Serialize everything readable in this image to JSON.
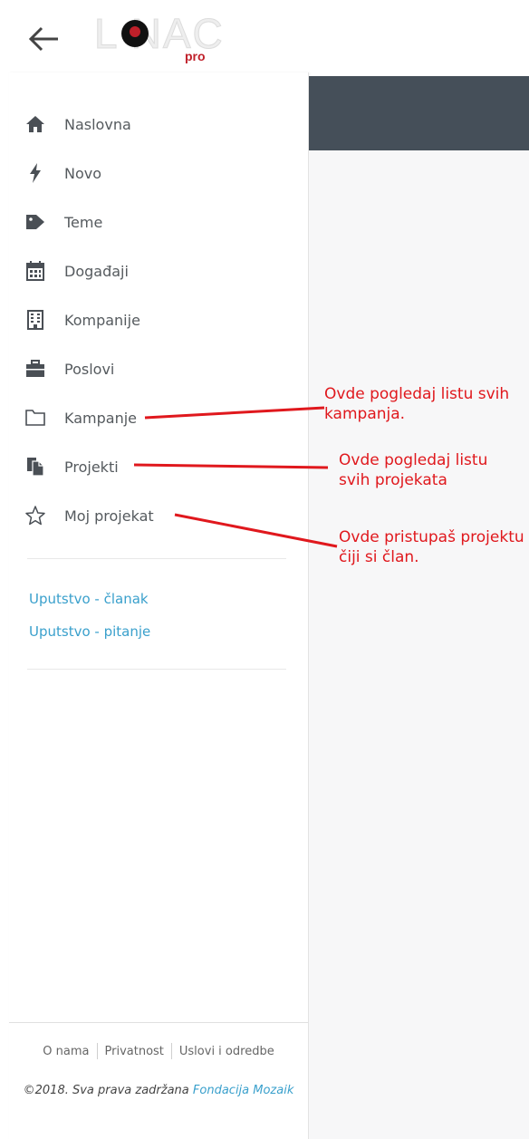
{
  "header": {
    "logo_text": "L NAC",
    "logo_sub": "pro"
  },
  "sidebar": {
    "items": [
      {
        "label": "Naslovna",
        "icon": "home-icon"
      },
      {
        "label": "Novo",
        "icon": "bolt-icon"
      },
      {
        "label": "Teme",
        "icon": "tag-icon"
      },
      {
        "label": "Događaji",
        "icon": "calendar-icon"
      },
      {
        "label": "Kompanije",
        "icon": "building-icon"
      },
      {
        "label": "Poslovi",
        "icon": "briefcase-icon"
      },
      {
        "label": "Kampanje",
        "icon": "folder-icon"
      },
      {
        "label": "Projekti",
        "icon": "copy-icon"
      },
      {
        "label": "Moj projekat",
        "icon": "star-icon"
      }
    ],
    "links": [
      "Uputstvo - članak",
      "Uputstvo - pitanje"
    ]
  },
  "footer": {
    "links": [
      "O nama",
      "Privatnost",
      "Uslovi i odredbe"
    ],
    "copyright_prefix": "©2018. Sva prava zadržana",
    "copyright_link": "Fondacija Mozaik"
  },
  "annotations": [
    {
      "line1": "Ovde pogledaj listu svih",
      "line2": "kampanja."
    },
    {
      "line1": "Ovde pogledaj listu",
      "line2": "svih projekata"
    },
    {
      "line1": "Ovde pristupaš projektu",
      "line2": "čiji si član."
    }
  ],
  "colors": {
    "annotation": "#e0181d",
    "link": "#3aa0cc",
    "header_band": "#454f59"
  }
}
